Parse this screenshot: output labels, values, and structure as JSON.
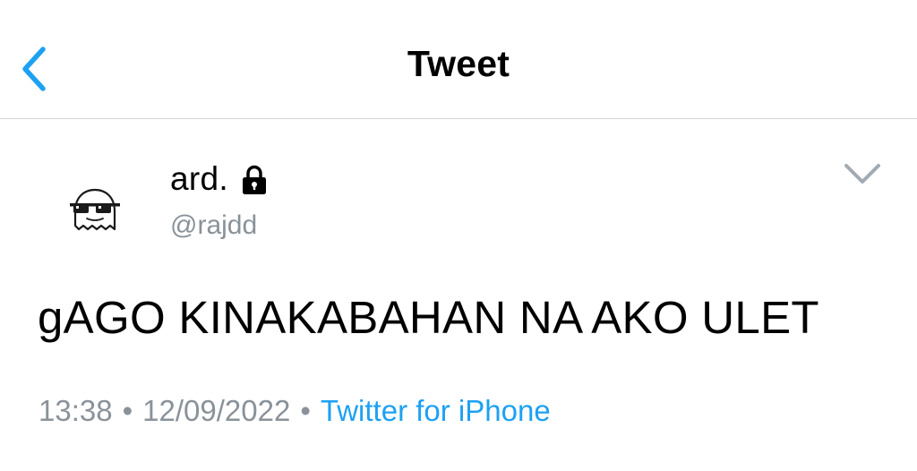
{
  "nav": {
    "title": "Tweet",
    "back_icon": "chevron-left-icon"
  },
  "tweet": {
    "display_name": "ard.",
    "protected_icon": "lock-icon",
    "handle": "@rajdd",
    "text": "gAGO KINAKABAHAN NA AKO ULET",
    "time": "13:38",
    "date": "12/09/2022",
    "separator": "•",
    "source": "Twitter for iPhone",
    "menu_icon": "chevron-down-icon"
  },
  "colors": {
    "accent": "#1da1f2",
    "muted": "#8a9299",
    "divider": "#d3d3d6",
    "text": "#000000"
  }
}
